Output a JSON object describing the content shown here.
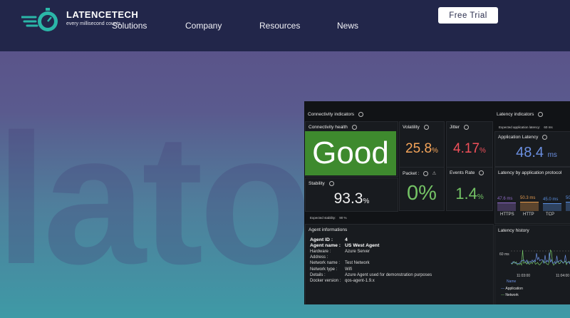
{
  "header": {
    "brand": "LATENCETECH",
    "tagline": "every millisecond counts",
    "nav": [
      "Solutions",
      "Company",
      "Resources",
      "News"
    ],
    "cta": "Free Trial"
  },
  "dashboard": {
    "connectivity_indicators": "Connectivity indicators",
    "connectivity_health": {
      "title": "Connectivity health",
      "value": "Good"
    },
    "volatility": {
      "title": "Volatility",
      "value": "25.8",
      "unit": "%"
    },
    "jitter": {
      "title": "Jitter",
      "value": "4.17",
      "unit": "%"
    },
    "stability": {
      "title": "Stability",
      "value": "93.3",
      "unit": "%"
    },
    "packet": {
      "title": "Packet :",
      "value": "0%"
    },
    "events_rate": {
      "title": "Events Rate",
      "value": "1.4",
      "unit": "%"
    },
    "expected_stability": {
      "label": "Expected stability:",
      "value": "90 %"
    },
    "agent_info": {
      "title": "Agent informations",
      "rows": [
        {
          "label": "Agent ID :",
          "value": "4"
        },
        {
          "label": "Agent name :",
          "value": "US West Agent"
        },
        {
          "label": "Hardware :",
          "value": "Azure Server"
        },
        {
          "label": "Address :",
          "value": ""
        },
        {
          "label": "Network name :",
          "value": "Test Network"
        },
        {
          "label": "Network type :",
          "value": "Wifi"
        },
        {
          "label": "Details :",
          "value": "Azure Agent used for demonstration purposes"
        },
        {
          "label": "Docker version :",
          "value": "qos-agent-1.9.x"
        }
      ]
    },
    "latency_indicators": "Latency indicators",
    "expected_app_latency": {
      "label": "Expected application latency:",
      "value": "60 ms"
    },
    "application_latency": {
      "title": "Application Latency",
      "value": "48.4",
      "unit": "ms"
    },
    "latency_by_protocol": {
      "title": "Latency by application protocol",
      "bars": [
        {
          "name": "HTTPS",
          "label": "47.6 ms",
          "value": 47.6,
          "color": "#8f6bc6"
        },
        {
          "name": "HTTP",
          "label": "50.3 ms",
          "value": 50.3,
          "color": "#e39a4e"
        },
        {
          "name": "TCP",
          "label": "45.0 ms",
          "value": 45.0,
          "color": "#5a8fe0"
        },
        {
          "name": "",
          "label": "50",
          "value": 50,
          "color": "#5a8fe0"
        }
      ]
    },
    "latency_history": {
      "title": "Latency history",
      "y_label": "60 ms",
      "x_labels": [
        "11:03:00",
        "11:04:00"
      ],
      "legend_header": "Name",
      "legend": [
        {
          "name": "Application",
          "color": "#6b8fe0"
        },
        {
          "name": "Network",
          "color": "#74c365"
        }
      ]
    },
    "colors": {
      "good": "#3e8a2e",
      "orange": "#f5a55a",
      "red": "#f0505a",
      "green": "#74c365",
      "blue": "#6b8fe0"
    }
  }
}
